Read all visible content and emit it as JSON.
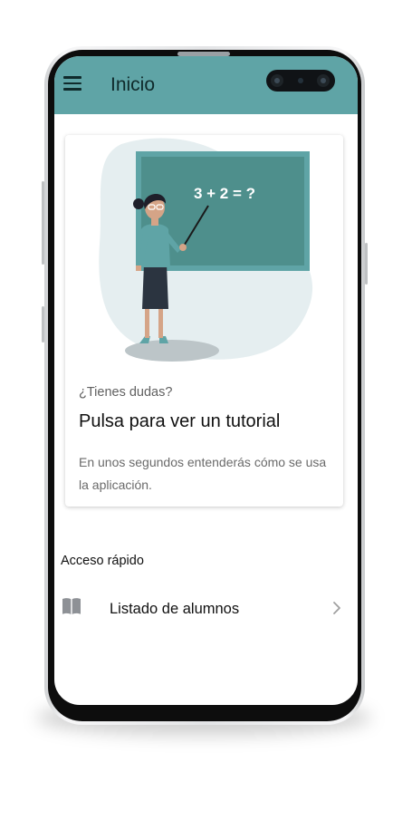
{
  "appbar": {
    "title": "Inicio",
    "menu_icon": "hamburger-menu-icon",
    "color": "#5fa4a6"
  },
  "tutorial_card": {
    "subtitle": "¿Tienes dudas?",
    "title": "Pulsa para ver un tutorial",
    "description": "En unos segundos entenderás cómo se usa la aplicación.",
    "illustration": {
      "blackboard_text": "3 + 2 = ?",
      "board_color": "#4e8f8c",
      "blob_color": "#e5eef0"
    }
  },
  "quick_access": {
    "label": "Acceso rápido",
    "items": [
      {
        "label": "Listado de alumnos",
        "icon": "book-icon",
        "trailing_icon": "chevron-right-icon"
      }
    ]
  }
}
